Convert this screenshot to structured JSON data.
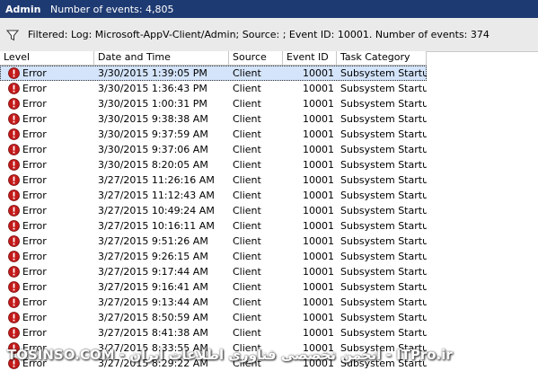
{
  "window": {
    "name": "Admin",
    "event_count": "Number of events: 4,805"
  },
  "filter": {
    "text": "Filtered: Log: Microsoft-AppV-Client/Admin; Source: ; Event ID: 10001. Number of events: 374"
  },
  "columns": [
    "Level",
    "Date and Time",
    "Source",
    "Event ID",
    "Task Category"
  ],
  "rows": [
    {
      "level": "Error",
      "date": "3/30/2015 1:39:05 PM",
      "source": "Client",
      "id": "10001",
      "category": "Subsystem Startup",
      "selected": true
    },
    {
      "level": "Error",
      "date": "3/30/2015 1:36:43 PM",
      "source": "Client",
      "id": "10001",
      "category": "Subsystem Startup"
    },
    {
      "level": "Error",
      "date": "3/30/2015 1:00:31 PM",
      "source": "Client",
      "id": "10001",
      "category": "Subsystem Startup"
    },
    {
      "level": "Error",
      "date": "3/30/2015 9:38:38 AM",
      "source": "Client",
      "id": "10001",
      "category": "Subsystem Startup"
    },
    {
      "level": "Error",
      "date": "3/30/2015 9:37:59 AM",
      "source": "Client",
      "id": "10001",
      "category": "Subsystem Startup"
    },
    {
      "level": "Error",
      "date": "3/30/2015 9:37:06 AM",
      "source": "Client",
      "id": "10001",
      "category": "Subsystem Startup"
    },
    {
      "level": "Error",
      "date": "3/30/2015 8:20:05 AM",
      "source": "Client",
      "id": "10001",
      "category": "Subsystem Startup"
    },
    {
      "level": "Error",
      "date": "3/27/2015 11:26:16 AM",
      "source": "Client",
      "id": "10001",
      "category": "Subsystem Startup"
    },
    {
      "level": "Error",
      "date": "3/27/2015 11:12:43 AM",
      "source": "Client",
      "id": "10001",
      "category": "Subsystem Startup"
    },
    {
      "level": "Error",
      "date": "3/27/2015 10:49:24 AM",
      "source": "Client",
      "id": "10001",
      "category": "Subsystem Startup"
    },
    {
      "level": "Error",
      "date": "3/27/2015 10:16:11 AM",
      "source": "Client",
      "id": "10001",
      "category": "Subsystem Startup"
    },
    {
      "level": "Error",
      "date": "3/27/2015 9:51:26 AM",
      "source": "Client",
      "id": "10001",
      "category": "Subsystem Startup"
    },
    {
      "level": "Error",
      "date": "3/27/2015 9:26:15 AM",
      "source": "Client",
      "id": "10001",
      "category": "Subsystem Startup"
    },
    {
      "level": "Error",
      "date": "3/27/2015 9:17:44 AM",
      "source": "Client",
      "id": "10001",
      "category": "Subsystem Startup"
    },
    {
      "level": "Error",
      "date": "3/27/2015 9:16:41 AM",
      "source": "Client",
      "id": "10001",
      "category": "Subsystem Startup"
    },
    {
      "level": "Error",
      "date": "3/27/2015 9:13:44 AM",
      "source": "Client",
      "id": "10001",
      "category": "Subsystem Startup"
    },
    {
      "level": "Error",
      "date": "3/27/2015 8:50:59 AM",
      "source": "Client",
      "id": "10001",
      "category": "Subsystem Startup"
    },
    {
      "level": "Error",
      "date": "3/27/2015 8:41:38 AM",
      "source": "Client",
      "id": "10001",
      "category": "Subsystem Startup"
    },
    {
      "level": "Error",
      "date": "3/27/2015 8:33:55 AM",
      "source": "Client",
      "id": "10001",
      "category": "Subsystem Startup"
    },
    {
      "level": "Error",
      "date": "3/27/2015 8:29:22 AM",
      "source": "Client",
      "id": "10001",
      "category": "Subsystem Startup"
    }
  ],
  "icons": {
    "filter": "funnel-icon",
    "error": "error-icon"
  },
  "colors": {
    "titlebar": "#1e3a72",
    "selection": "#d4e4fa",
    "error_icon": "#c41a1a"
  },
  "watermark": "TOSINSO.COM - انجمن تخصصی فناوری اطلاعات ایران - ITPro.ir"
}
